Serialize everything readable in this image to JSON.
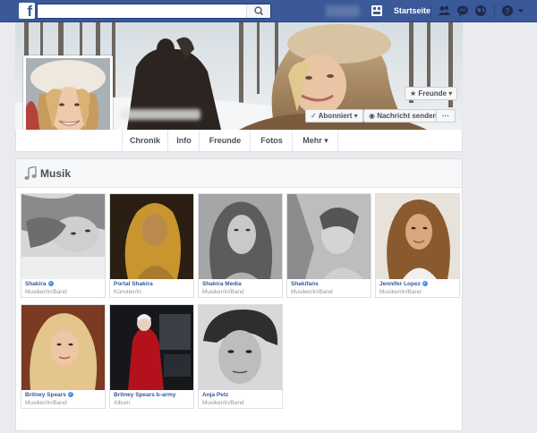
{
  "topbar": {
    "logo": "f",
    "search_placeholder": "",
    "startseite": "Startseite"
  },
  "profile": {
    "friends_button": "Freunde",
    "subscribed_button": "Abonniert",
    "message_button": "Nachricht senden",
    "more_button": "···"
  },
  "nav": {
    "tabs": [
      "Chronik",
      "Info",
      "Freunde",
      "Fotos",
      "Mehr"
    ]
  },
  "music": {
    "title": "Musik",
    "items": [
      {
        "name": "Shakira",
        "category": "Musiker/in/Band",
        "verified": true
      },
      {
        "name": "Portal Shakira",
        "category": "Künstler/in",
        "verified": false
      },
      {
        "name": "Shakira Media",
        "category": "Musiker/in/Band",
        "verified": false
      },
      {
        "name": "Shakifans",
        "category": "Musiker/in/Band",
        "verified": false
      },
      {
        "name": "Jennifer Lopez",
        "category": "Musiker/in/Band",
        "verified": true
      },
      {
        "name": "Britney Spears",
        "category": "Musiker/in/Band",
        "verified": true
      },
      {
        "name": "Britney Spears b-army",
        "category": "Album",
        "verified": false
      },
      {
        "name": "Anja Petz",
        "category": "Musiker/in/Band",
        "verified": false
      }
    ]
  },
  "colors": {
    "brand": "#3b5998",
    "link": "#365899",
    "verified": "#4a90e2"
  }
}
